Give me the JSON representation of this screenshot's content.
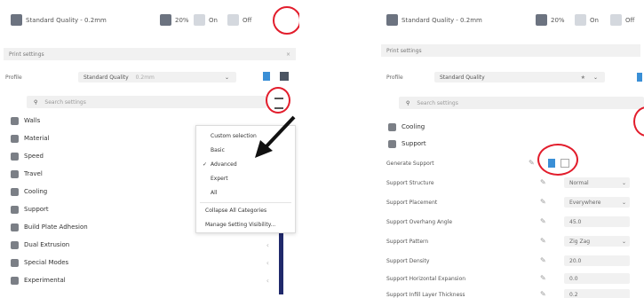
{
  "left": {
    "topbar": {
      "quality": "Standard Quality - 0.2mm",
      "infill": "20%",
      "support": "On",
      "adhesion": "Off"
    },
    "print_settings": "Print settings",
    "profile_label": "Profile",
    "profile_value": "Standard Quality",
    "profile_hint": "0.2mm",
    "search_placeholder": "Search settings",
    "categories": [
      "Walls",
      "Material",
      "Speed",
      "Travel",
      "Cooling",
      "Support",
      "Build Plate Adhesion",
      "Dual Extrusion",
      "Special Modes",
      "Experimental"
    ],
    "menu": {
      "items": [
        "Custom selection",
        "Basic",
        "Advanced",
        "Expert",
        "All"
      ],
      "checked_item": "Advanced",
      "actions": [
        "Collapse All Categories",
        "Manage Setting Visibility..."
      ]
    }
  },
  "right": {
    "topbar": {
      "quality": "Standard Quality - 0.2mm",
      "infill": "20%",
      "support": "On",
      "adhesion": "Off"
    },
    "print_settings": "Print settings",
    "profile_label": "Profile",
    "profile_value": "Standard Quality",
    "search_placeholder": "Search settings",
    "categories": [
      "Cooling",
      "Support"
    ],
    "settings": [
      {
        "label": "Generate Support",
        "value": ""
      },
      {
        "label": "Support Structure",
        "value": "Normal"
      },
      {
        "label": "Support Placement",
        "value": "Everywhere"
      },
      {
        "label": "Support Overhang Angle",
        "value": "45.0"
      },
      {
        "label": "Support Pattern",
        "value": "Zig Zag"
      },
      {
        "label": "Support Density",
        "value": "20.0"
      },
      {
        "label": "Support Horizontal Expansion",
        "value": "0.0"
      },
      {
        "label": "Support Infill Layer Thickness",
        "value": "0.2"
      }
    ]
  }
}
